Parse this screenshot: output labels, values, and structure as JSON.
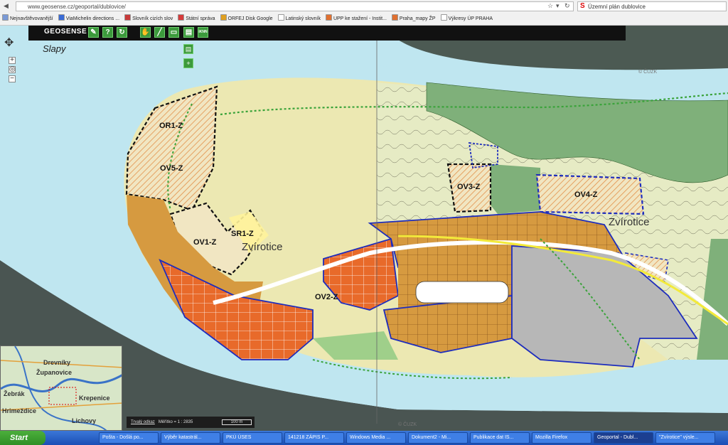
{
  "browser": {
    "url": "www.geosense.cz/geoportal/dublovice/",
    "search": "Územní plán dublovice",
    "bookmarks": [
      "Nejnavštěvovanější",
      "ViaMichelin directions ...",
      "Slovník cizích slov",
      "Státní správa",
      "ORFEJ Disk Google",
      "Latinský slovník",
      "UPP ke stažení - Instit...",
      "Praha_mapy ŽP",
      "Výkresy ÚP PRAHA"
    ],
    "bookmark_colors": [
      "#7a9ad6",
      "#3a6bd6",
      "#c83a3a",
      "#d63a3a",
      "#e0a020",
      "#fff",
      "#e07030",
      "#e07030",
      "#fff"
    ]
  },
  "toolbar": {
    "logo": "GEOSENSE",
    "buttons": [
      "wrench-icon",
      "help-icon",
      "refresh-icon",
      "hand-icon",
      "ruler-icon",
      "folder-icon",
      "print-icon",
      "iknn-icon"
    ],
    "iknn_label": "iKNN"
  },
  "map": {
    "town_label": "Slapy",
    "zones": [
      "OR1-Z",
      "OV5-Z",
      "SR1-Z",
      "OV1-Z",
      "OV2-Z",
      "OV3-Z",
      "OV4-Z"
    ],
    "places": [
      "Zvírotice",
      "Zvírotice"
    ],
    "watermark": "© ČUZK",
    "colors": {
      "river": "#bfe6f0",
      "land": "#ece8b2",
      "forest": "#7fb07a",
      "built_orange": "#e86a2a",
      "built_brown": "#d69a40",
      "gray": "#b7b7b7",
      "zone_boundary": "#1e2dbd"
    }
  },
  "overview": {
    "labels": [
      "Drevníky",
      "Županovice",
      "Žebrák",
      "Krepenice",
      "Hrimeždice",
      "Lichovy"
    ]
  },
  "scale": {
    "link": "Trvalý odkaz",
    "ratio": "Měřítko = 1 : 2835",
    "box": "100 m"
  },
  "taskbar": {
    "start": "Start",
    "tasks": [
      "Pošta - Došlá po...",
      "Výběr katastrál...",
      "PKÚ ÚSES",
      "141218 ZÁPIS P...",
      "Windows Media ...",
      "Dokument2 - Mi...",
      "Publikace dat IS...",
      "Mozilla Firefox",
      "Geoportal - Dubl...",
      "\"Zvírotice\" výsle..."
    ]
  }
}
